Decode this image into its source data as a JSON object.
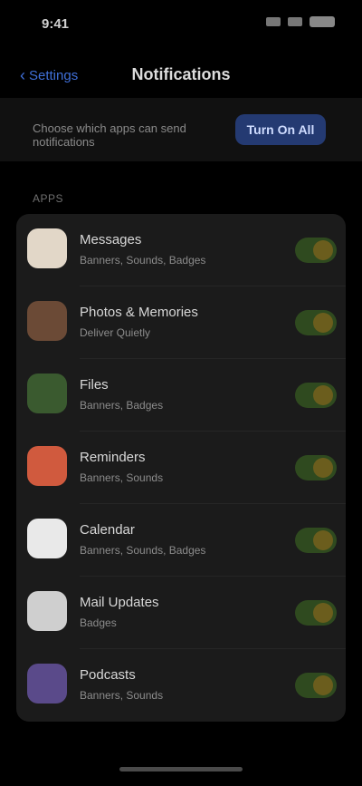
{
  "status": {
    "time": "9:41"
  },
  "header": {
    "back_label": "Settings",
    "title": "Notifications"
  },
  "filter": {
    "label": "Choose which apps can send notifications",
    "button_label": "Turn On All"
  },
  "section": {
    "label": "APPS"
  },
  "apps": [
    {
      "name": "Messages",
      "detail": "Banners, Sounds, Badges",
      "icon_color": "#e2d7c8",
      "enabled": true
    },
    {
      "name": "Photos & Memories",
      "detail": "Deliver Quietly",
      "icon_color": "#6b4a36",
      "enabled": true
    },
    {
      "name": "Files",
      "detail": "Banners, Badges",
      "icon_color": "#3a5a2f",
      "enabled": true
    },
    {
      "name": "Reminders",
      "detail": "Banners, Sounds",
      "icon_color": "#d05a3e",
      "enabled": true
    },
    {
      "name": "Calendar",
      "detail": "Banners, Sounds, Badges",
      "icon_color": "#e9e9e9",
      "enabled": true
    },
    {
      "name": "Mail Updates",
      "detail": "Badges",
      "icon_color": "#cfcfcf",
      "enabled": true
    },
    {
      "name": "Podcasts",
      "detail": "Banners, Sounds",
      "icon_color": "#5a4a8a",
      "enabled": true
    }
  ],
  "colors": {
    "accent": "#3f6fd8",
    "toggle_track": "#2f4a1f",
    "toggle_knob": "#6b5d1d",
    "card_bg": "#1b1b1b"
  }
}
